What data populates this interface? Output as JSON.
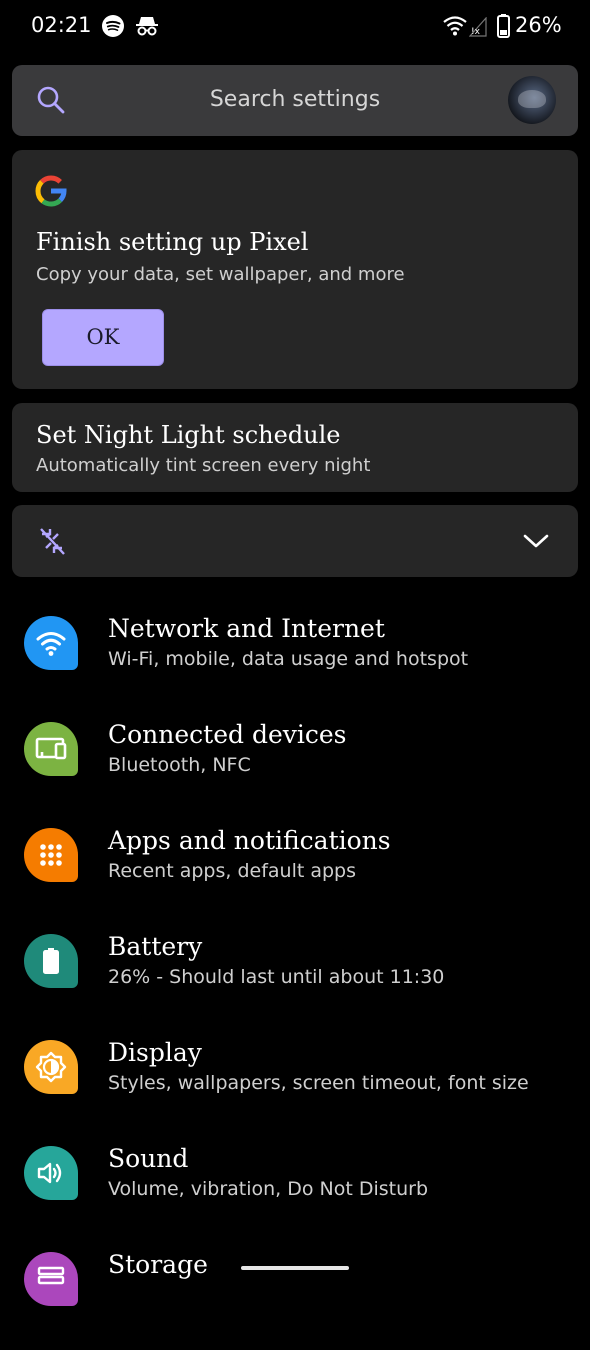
{
  "status_bar": {
    "time": "02:21",
    "battery_percent": "26%",
    "icons": [
      "spotify-icon",
      "incognito-icon",
      "wifi-icon",
      "signal-icon",
      "battery-icon"
    ]
  },
  "search": {
    "placeholder": "Search settings"
  },
  "suggestions": {
    "setup": {
      "title": "Finish setting up Pixel",
      "subtitle": "Copy your data, set wallpaper, and more",
      "button_label": "OK"
    },
    "night_light": {
      "title": "Set Night Light schedule",
      "subtitle": "Automatically tint screen every night"
    }
  },
  "settings": [
    {
      "title": "Network and Internet",
      "subtitle": "Wi-Fi, mobile, data usage and hotspot",
      "icon": "wifi-icon",
      "color": "#2196f3"
    },
    {
      "title": "Connected devices",
      "subtitle": "Bluetooth, NFC",
      "icon": "devices-icon",
      "color": "#7cb342"
    },
    {
      "title": "Apps and notifications",
      "subtitle": "Recent apps, default apps",
      "icon": "apps-grid-icon",
      "color": "#f57c00"
    },
    {
      "title": "Battery",
      "subtitle": "26% - Should last until about 11:30",
      "icon": "battery-icon",
      "color": "#1f8a7a"
    },
    {
      "title": "Display",
      "subtitle": "Styles, wallpapers, screen timeout, font size",
      "icon": "brightness-icon",
      "color": "#f9a825"
    },
    {
      "title": "Sound",
      "subtitle": "Volume, vibration, Do Not Disturb",
      "icon": "volume-icon",
      "color": "#26a69a"
    },
    {
      "title": "Storage",
      "subtitle": "",
      "icon": "storage-icon",
      "color": "#ab47bc"
    }
  ],
  "colors": {
    "accent": "#b4a7ff",
    "card_bg": "#262626",
    "search_bg": "#3a3a3c"
  }
}
